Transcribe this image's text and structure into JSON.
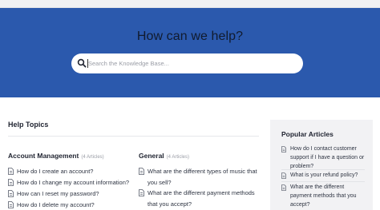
{
  "hero": {
    "title": "How can we help?",
    "search_placeholder": "Search the Knowledge Base...",
    "search_icon": "search-icon",
    "background_color": "#2b59ad"
  },
  "help_topics": {
    "title": "Help Topics",
    "categories": [
      {
        "name": "Account Management",
        "count": "(4 Articles)",
        "articles": [
          "How do I create an account?",
          "How do I change my account information?",
          "How can I reset my password?",
          "How do I delete my account?"
        ]
      },
      {
        "name": "General",
        "count": "(4 Articles)",
        "articles": [
          "What are the different types of music that you sell?",
          "What are the different payment methods that you accept?"
        ]
      }
    ]
  },
  "sidebar": {
    "title": "Popular Articles",
    "articles": [
      "How do I contact customer support if I have a question or problem?",
      "What is your refund policy?",
      "What are the different payment methods that you accept?"
    ]
  }
}
